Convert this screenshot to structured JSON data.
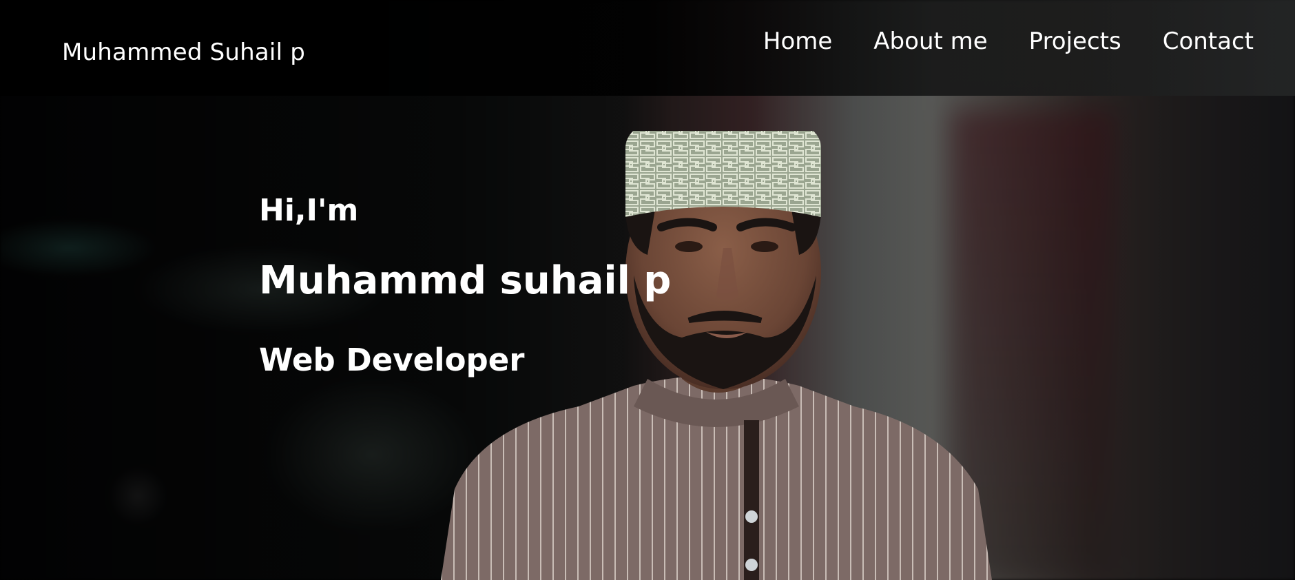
{
  "navbar": {
    "brand": "Muhammed Suhail p",
    "links": [
      {
        "label": "Home"
      },
      {
        "label": "About me"
      },
      {
        "label": "Projects"
      },
      {
        "label": "Contact"
      }
    ]
  },
  "hero": {
    "greeting": "Hi,I'm",
    "name": "Muhammd suhail p",
    "role": "Web Developer"
  },
  "colors": {
    "text": "#ffffff",
    "navbar_bg": "#000000"
  }
}
